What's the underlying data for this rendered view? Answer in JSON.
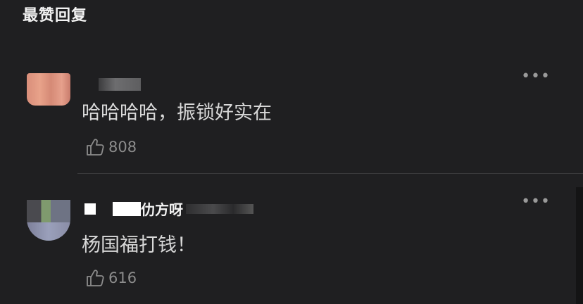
{
  "section": {
    "title": "最赞回复"
  },
  "comments": [
    {
      "nickname": "",
      "text": "哈哈哈哈，振锁好实在",
      "likes": "808",
      "more": "•••"
    },
    {
      "nickname": "仂方呀",
      "text": "杨国福打钱！",
      "likes": "616",
      "more": "•••"
    }
  ],
  "icons": {
    "like": "thumbs-up-icon",
    "more": "more-dots-icon"
  },
  "colors": {
    "background": "#1f1f21",
    "text": "#d8d8d8",
    "muted": "#8c8c8c"
  }
}
